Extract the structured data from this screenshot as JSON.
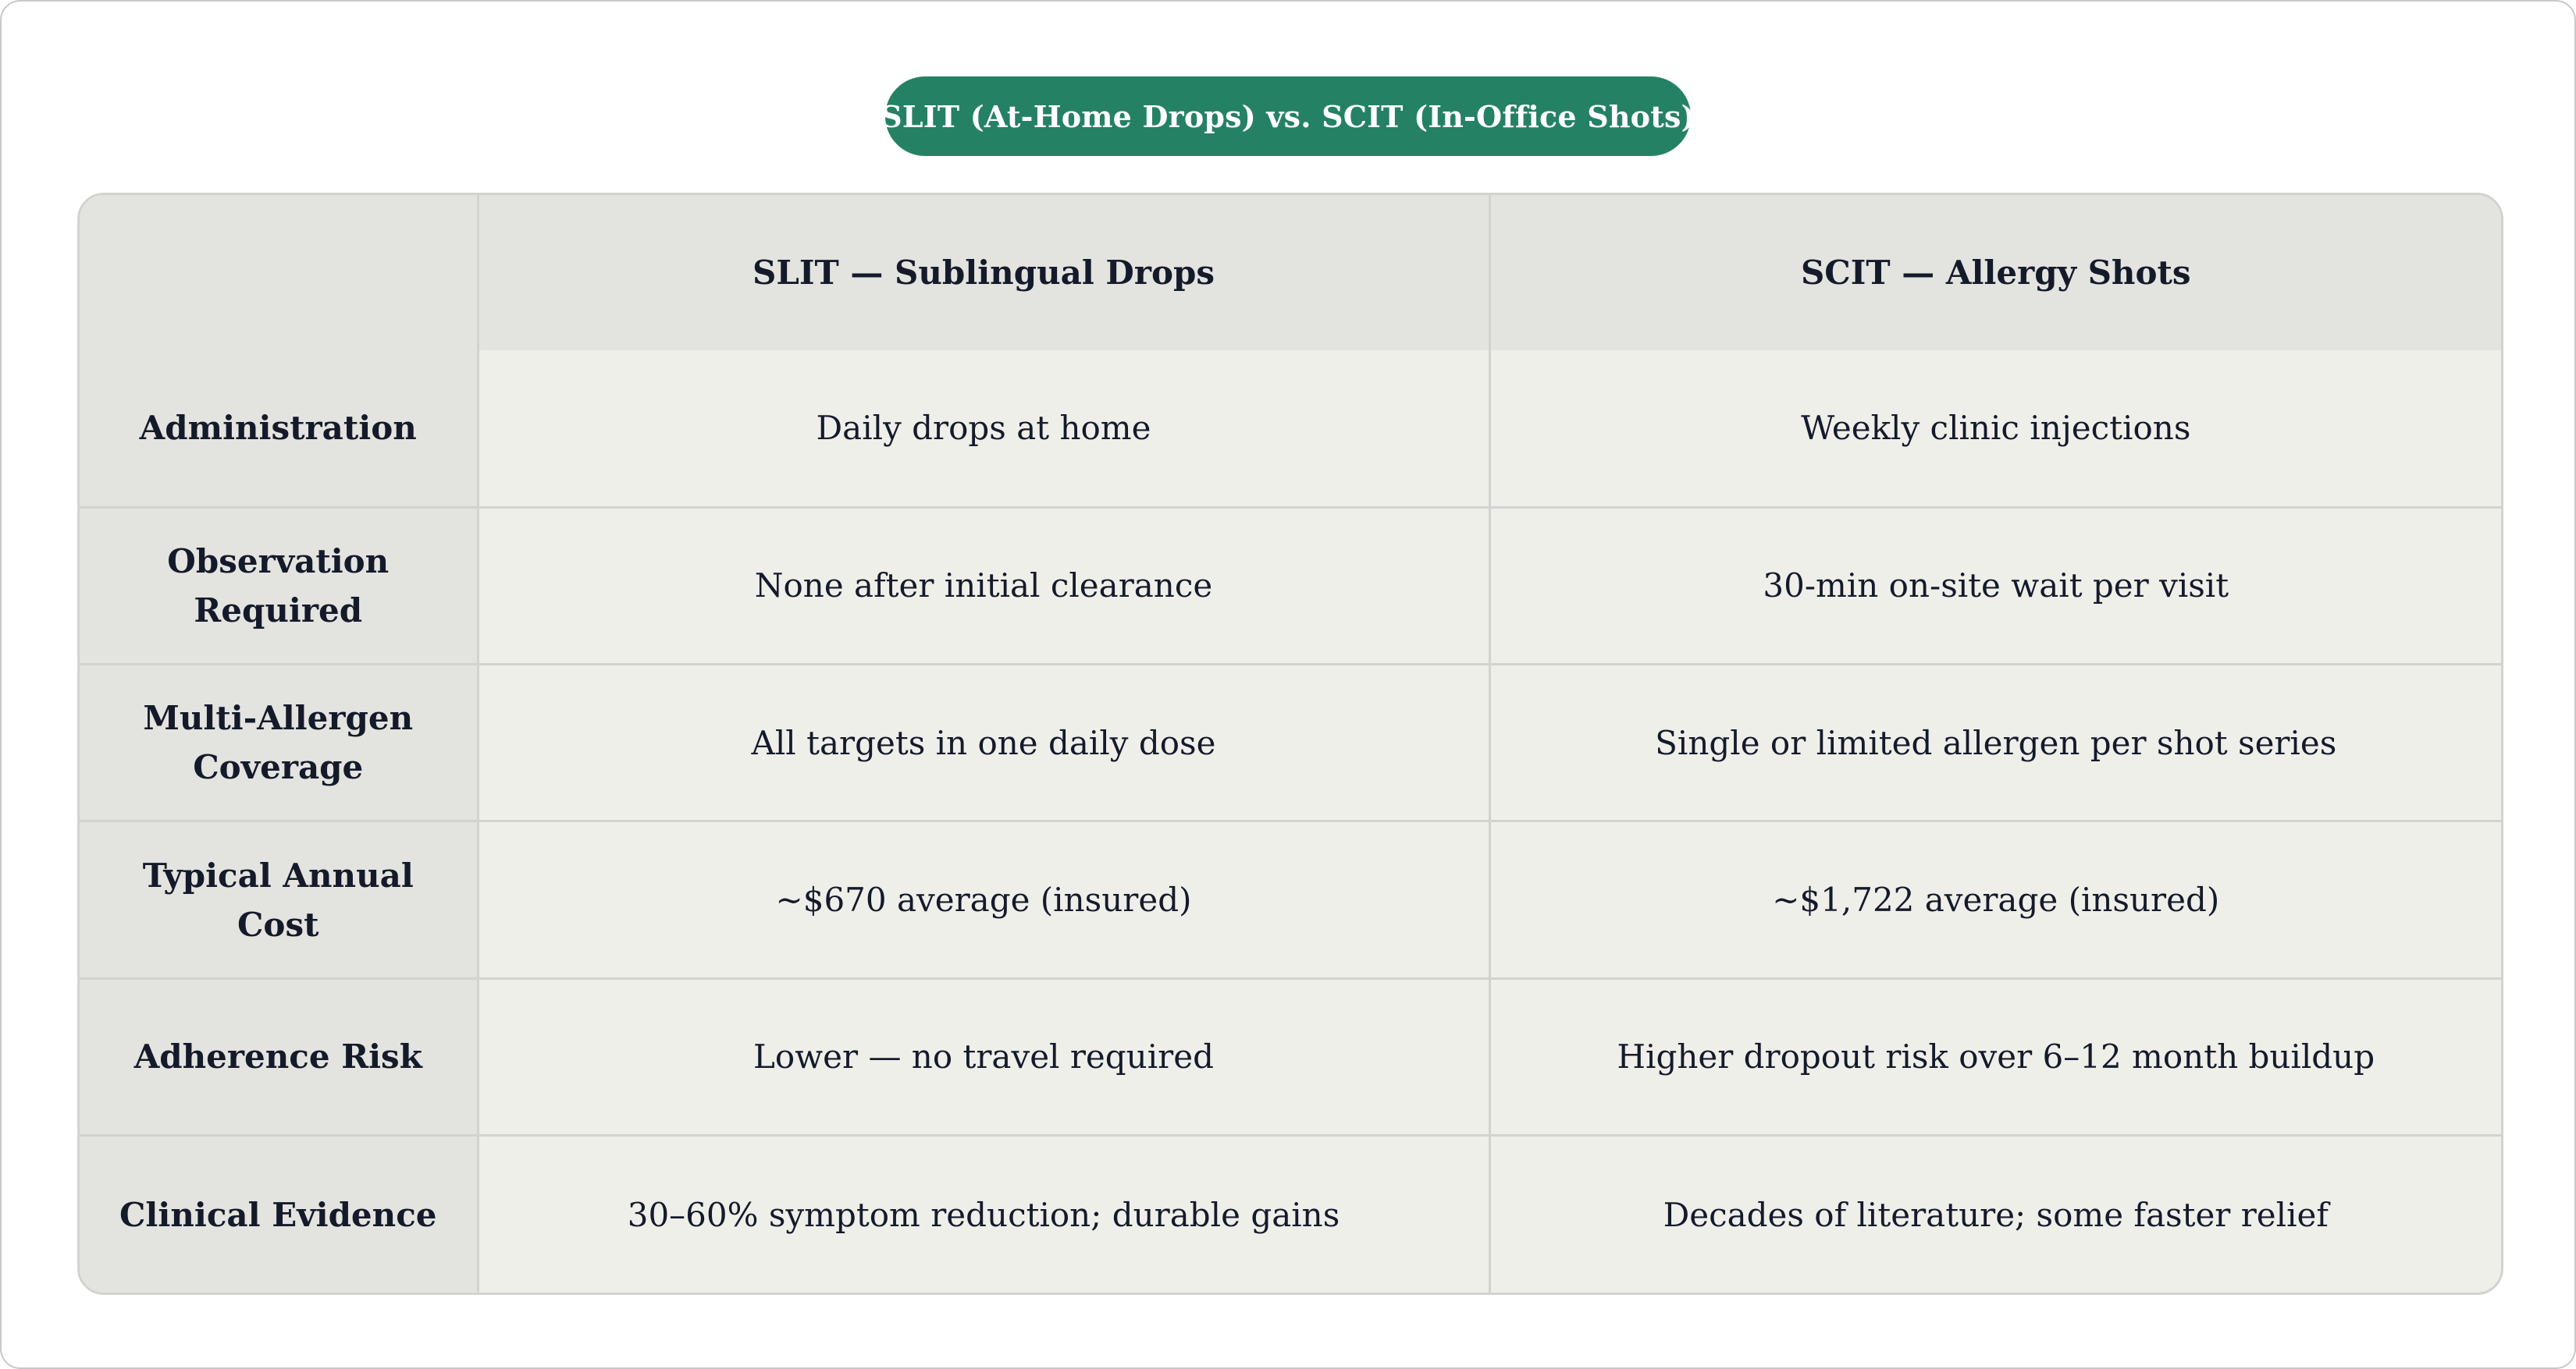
{
  "title": "SLIT (At-Home Drops) vs. SCIT (In-Office Shots)",
  "colors": {
    "title_pill": "#258164",
    "header_bg": "#e3e4df",
    "cell_bg": "#efefea",
    "border": "#d2d3ce",
    "text": "#151a2b"
  },
  "table": {
    "columns": [
      "",
      "SLIT — Sublingual Drops",
      "SCIT — Allergy Shots"
    ],
    "rows": [
      {
        "label": "Administration",
        "slit": "Daily drops at home",
        "scit": "Weekly clinic injections"
      },
      {
        "label": "Observation Required",
        "slit": "None after initial clearance",
        "scit": "30-min on-site wait per visit"
      },
      {
        "label": "Multi-Allergen Coverage",
        "slit": "All targets in one daily dose",
        "scit": "Single or limited allergen per shot series"
      },
      {
        "label": "Typical Annual Cost",
        "slit": "~$670 average (insured)",
        "scit": "~$1,722 average (insured)"
      },
      {
        "label": "Adherence Risk",
        "slit": "Lower — no travel required",
        "scit": "Higher dropout risk over 6–12 month buildup"
      },
      {
        "label": "Clinical Evidence",
        "slit": "30–60% symptom reduction; durable gains",
        "scit": "Decades of literature; some faster relief"
      }
    ]
  }
}
